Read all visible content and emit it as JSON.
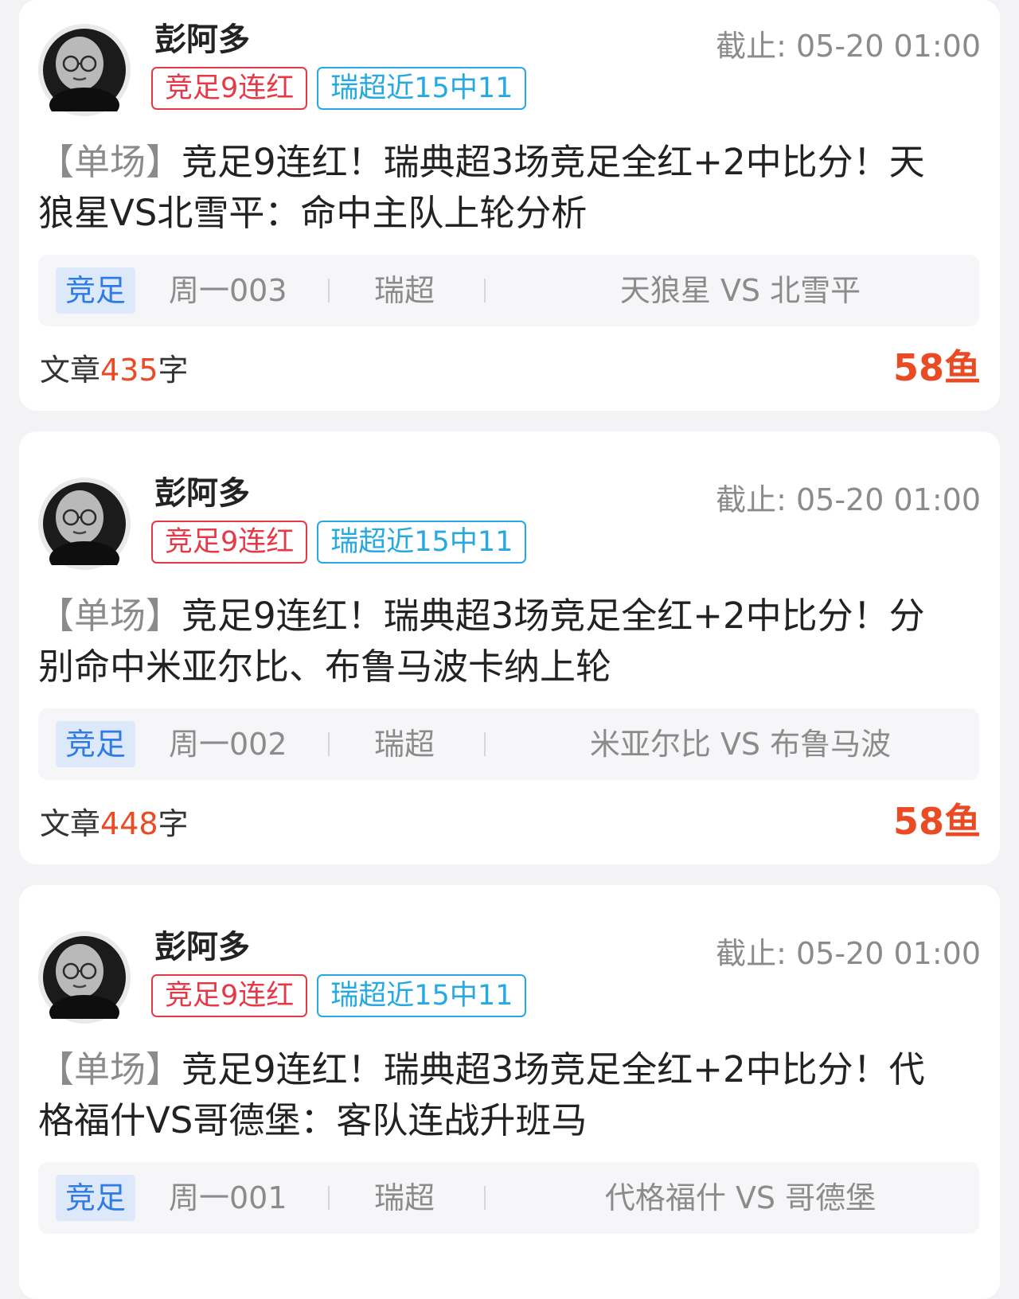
{
  "colors": {
    "accent_red": "#ea4a24",
    "badge_red": "#e53948",
    "badge_blue": "#26a9e0",
    "league_tag_blue": "#2f7be6"
  },
  "posts": [
    {
      "author": "彭阿多",
      "badges": [
        {
          "label": "竞足9连红",
          "color": "#e53948"
        },
        {
          "label": "瑞超近15中11",
          "color": "#26a9e0"
        }
      ],
      "deadline_label": "截止:",
      "deadline_time": "05-20 01:00",
      "title_prefix": "【单场】",
      "title_body": "竞足9连红！瑞典超3场竞足全红+2中比分！天狼星VS北雪平：命中主队上轮分析",
      "match": {
        "type": "竞足",
        "number": "周一003",
        "league": "瑞超",
        "teams": "天狼星 VS 北雪平"
      },
      "article_prefix": "文章",
      "word_count": "435",
      "article_suffix": "字",
      "price": "58鱼"
    },
    {
      "author": "彭阿多",
      "badges": [
        {
          "label": "竞足9连红",
          "color": "#e53948"
        },
        {
          "label": "瑞超近15中11",
          "color": "#26a9e0"
        }
      ],
      "deadline_label": "截止:",
      "deadline_time": "05-20 01:00",
      "title_prefix": "【单场】",
      "title_body": "竞足9连红！瑞典超3场竞足全红+2中比分！分别命中米亚尔比、布鲁马波卡纳上轮",
      "match": {
        "type": "竞足",
        "number": "周一002",
        "league": "瑞超",
        "teams": "米亚尔比 VS 布鲁马波"
      },
      "article_prefix": "文章",
      "word_count": "448",
      "article_suffix": "字",
      "price": "58鱼"
    },
    {
      "author": "彭阿多",
      "badges": [
        {
          "label": "竞足9连红",
          "color": "#e53948"
        },
        {
          "label": "瑞超近15中11",
          "color": "#26a9e0"
        }
      ],
      "deadline_label": "截止:",
      "deadline_time": "05-20 01:00",
      "title_prefix": "【单场】",
      "title_body": "竞足9连红！瑞典超3场竞足全红+2中比分！代格福什VS哥德堡：客队连战升班马",
      "match": {
        "type": "竞足",
        "number": "周一001",
        "league": "瑞超",
        "teams": "代格福什 VS 哥德堡"
      }
    }
  ]
}
